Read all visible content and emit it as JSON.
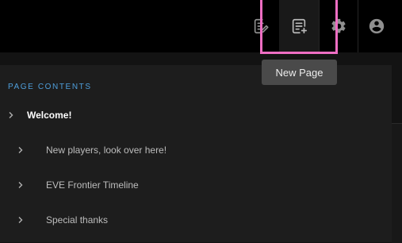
{
  "toolbar": {
    "edit_icon": "edit-note-icon",
    "new_page_icon": "new-page-icon",
    "settings_icon": "gear-icon",
    "account_icon": "account-circle-icon"
  },
  "tooltip": {
    "text": "New Page"
  },
  "toc": {
    "title": "PAGE CONTENTS",
    "items": [
      {
        "label": "Welcome!"
      },
      {
        "label": "New players, look over here!"
      },
      {
        "label": "EVE Frontier Timeline"
      },
      {
        "label": "Special thanks"
      }
    ]
  },
  "colors": {
    "highlight": "#ee6ec3",
    "toc_title": "#4f9fdc",
    "background": "#131313",
    "topbar": "#000000"
  }
}
